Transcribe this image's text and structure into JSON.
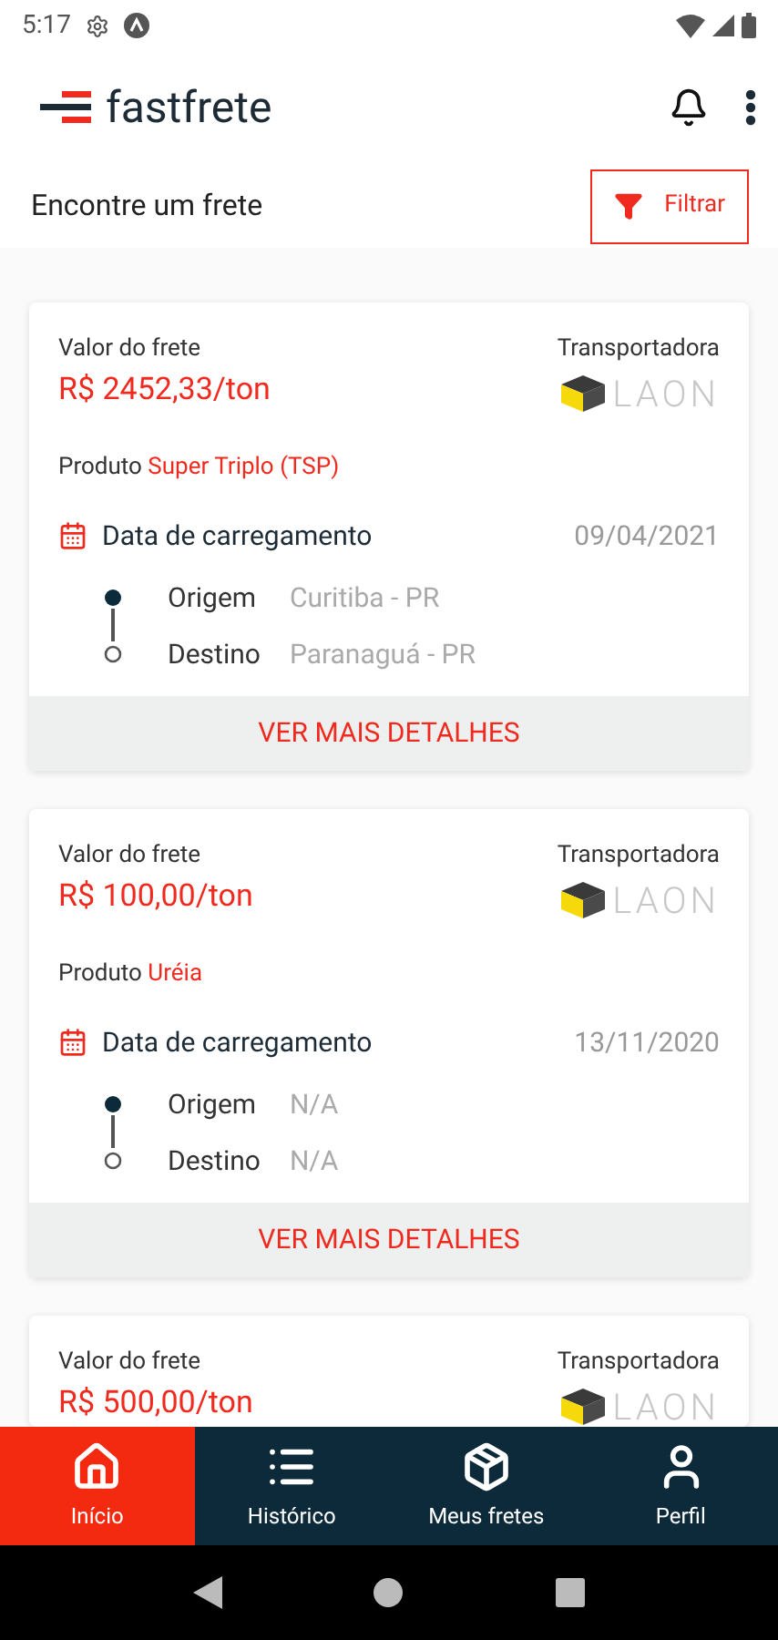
{
  "status_bar": {
    "time": "5:17"
  },
  "app_bar": {
    "logo_text": "fastfrete"
  },
  "toolbar": {
    "title": "Encontre um frete",
    "filter_button": "Filtrar"
  },
  "freights": [
    {
      "price_label": "Valor do frete",
      "price": "R$ 2452,33/ton",
      "carrier_label": "Transportadora",
      "carrier_logo": "LAON",
      "product_label": "Produto",
      "product": "Super Triplo (TSP)",
      "date_label": "Data de carregamento",
      "date": "09/04/2021",
      "origin_label": "Origem",
      "origin": "Curitiba - PR",
      "destination_label": "Destino",
      "destination": "Paranaguá - PR",
      "details_button": "VER MAIS DETALHES"
    },
    {
      "price_label": "Valor do frete",
      "price": "R$ 100,00/ton",
      "carrier_label": "Transportadora",
      "carrier_logo": "LAON",
      "product_label": "Produto",
      "product": "Uréia",
      "date_label": "Data de carregamento",
      "date": "13/11/2020",
      "origin_label": "Origem",
      "origin": "N/A",
      "destination_label": "Destino",
      "destination": "N/A",
      "details_button": "VER MAIS DETALHES"
    },
    {
      "price_label": "Valor do frete",
      "price": "R$ 500,00/ton",
      "carrier_label": "Transportadora",
      "carrier_logo": "LAON"
    }
  ],
  "bottom_nav": [
    {
      "label": "Início",
      "kind": "home",
      "selected": true
    },
    {
      "label": "Histórico",
      "kind": "list",
      "selected": false
    },
    {
      "label": "Meus fretes",
      "kind": "box",
      "selected": false
    },
    {
      "label": "Perfil",
      "kind": "user",
      "selected": false
    }
  ]
}
